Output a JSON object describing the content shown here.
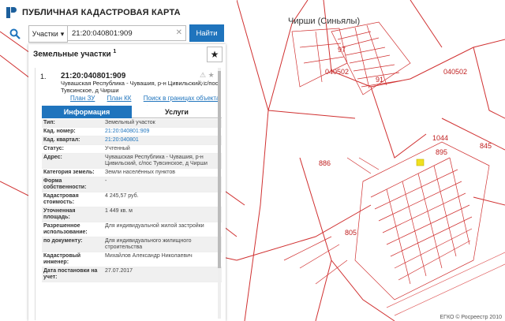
{
  "app": {
    "title": "ПУБЛИЧНАЯ КАДАСТРОВАЯ КАРТА"
  },
  "search": {
    "type_label": "Участки",
    "query": "21:20:040801:909",
    "button": "Найти"
  },
  "panel": {
    "title": "Земельные участки",
    "count": "1"
  },
  "item": {
    "num": "1.",
    "code": "21:20:040801:909",
    "address": "Чувашская Республика - Чувашия, р-н Цивильский, с/пос Тувсинское, д Чирши",
    "links": [
      "План ЗУ →",
      "План КК →",
      "Поиск в границах объекта →"
    ]
  },
  "tabs": [
    {
      "label": "Информация"
    },
    {
      "label": "Услуги"
    }
  ],
  "rows": [
    {
      "label": "Тип:",
      "value": "Земельный участок"
    },
    {
      "label": "Кад. номер:",
      "value": "21:20:040801:909"
    },
    {
      "label": "Кад. квартал:",
      "value": "21:20:040801"
    },
    {
      "label": "Статус:",
      "value": "Учтенный"
    },
    {
      "label": "Адрес:",
      "value": "Чувашская Республика - Чувашия, р-н Цивильский, с/пос Тувсинское, д Чирши"
    },
    {
      "label": "Категория земель:",
      "value": "Земли населённых пунктов"
    },
    {
      "label": "Форма собственности:",
      "value": "-"
    },
    {
      "label": "Кадастровая стоимость:",
      "value": "4 245,57 руб."
    },
    {
      "label": "Уточненная площадь:",
      "value": "1 449 кв. м"
    },
    {
      "label": "Разрешенное использование:",
      "value": "Для индивидуальной жилой застройки"
    },
    {
      "label": "по документу:",
      "value": "Для индивидуального жилищного строительства"
    },
    {
      "label": "Кадастровый инженер:",
      "value": "Михайлов Александр Николаевич"
    },
    {
      "label": "Дата постановки на учет:",
      "value": "27.07.2017"
    }
  ],
  "map": {
    "village": "Чирши (Синьялы)",
    "labels": [
      "97",
      "040502",
      "91",
      "040502",
      "1044",
      "895",
      "845",
      "886",
      "805"
    ],
    "copyright": "ЕГКО © Росреестр 2010"
  },
  "colors": {
    "accent": "#1f74bd",
    "boundary": "#d03030",
    "highlight": "#f0e020"
  }
}
